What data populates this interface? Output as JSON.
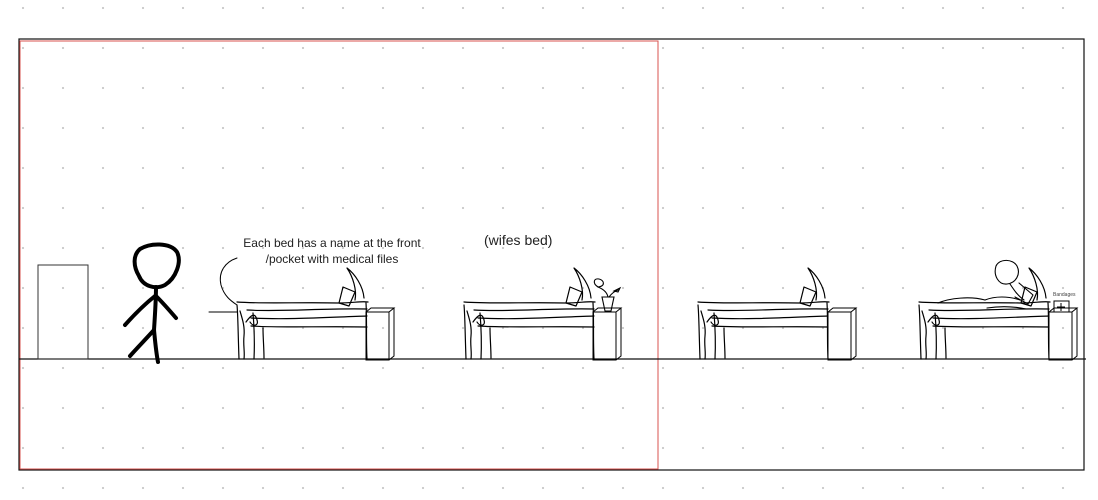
{
  "annotations": {
    "bed_name_note_line1": "Each bed has a name at the front",
    "bed_name_note_line2": "/pocket with medical files",
    "wife_bed_label": "(wifes bed)",
    "bandages_label": "Bandages"
  },
  "colors": {
    "ink": "#000000",
    "frame": "#111111",
    "highlight_frame": "#d9534f",
    "grid_dots": "#c9c9c9",
    "background": "#ffffff"
  },
  "icons": [
    "door-icon",
    "stick-figure-icon",
    "bed-icon",
    "nightstand-icon",
    "flower-vase-icon",
    "bandage-box-icon",
    "patient-figure-icon"
  ]
}
